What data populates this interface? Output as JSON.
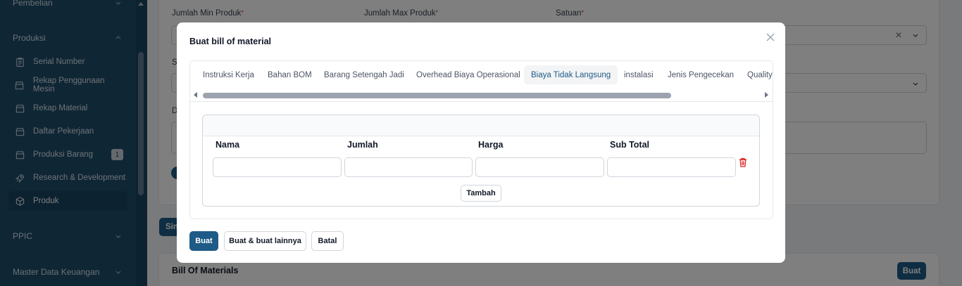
{
  "sidebar": {
    "group_pembelian": "Pembelian",
    "group_produksi": "Produksi",
    "items": [
      {
        "label": "Serial Number",
        "icon": "clipboard-icon"
      },
      {
        "label": "Rekap Penggunaan Mesin",
        "icon": "box-icon"
      },
      {
        "label": "Rekap Material",
        "icon": "box-icon"
      },
      {
        "label": "Daftar Pekerjaan",
        "icon": "box-icon"
      },
      {
        "label": "Produksi Barang",
        "icon": "box-icon",
        "badge": "1"
      },
      {
        "label": "Research & Development",
        "icon": "rocket-icon"
      },
      {
        "label": "Produk",
        "icon": "cube-icon",
        "active": true
      }
    ],
    "group_ppic": "PPIC",
    "group_master_keuangan": "Master Data Keuangan"
  },
  "background": {
    "label_min": "Jumlah Min Produk",
    "label_max": "Jumlah Max Produk",
    "label_satuan": "Satuan",
    "label_s": "S",
    "label_d": "D",
    "simpan_partial": "Sin",
    "bom_section_title": "Bill Of Materials",
    "bom_button": "Buat"
  },
  "modal": {
    "title": "Buat bill of material",
    "tabs": [
      {
        "label": "Instruksi Kerja"
      },
      {
        "label": "Bahan BOM"
      },
      {
        "label": "Barang Setengah Jadi"
      },
      {
        "label": "Overhead Biaya Operasional"
      },
      {
        "label": "Biaya Tidak Langsung",
        "active": true
      },
      {
        "label": "instalasi"
      },
      {
        "label": "Jenis Pengecekan"
      },
      {
        "label": "Quality"
      }
    ],
    "table": {
      "columns": [
        "Nama",
        "Jumlah",
        "Harga",
        "Sub Total"
      ],
      "row_values": [
        "",
        "",
        "",
        ""
      ]
    },
    "add_button": "Tambah",
    "buttons": {
      "create": "Buat",
      "create_another": "Buat & buat lainnya",
      "cancel": "Batal"
    }
  },
  "colors": {
    "sidebar": "#1e4d6b",
    "primary": "#1e5b86",
    "danger": "#dc2626"
  }
}
